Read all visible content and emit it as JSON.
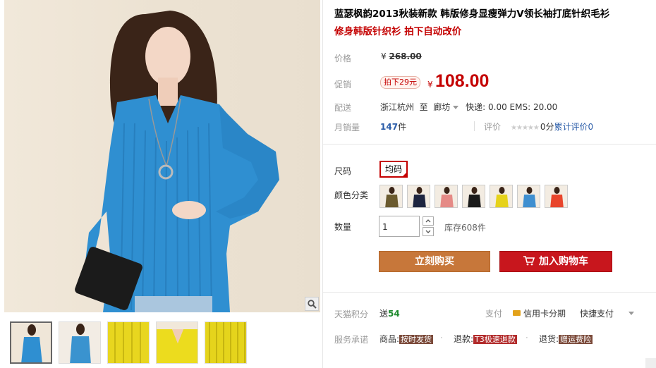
{
  "product": {
    "title": "蓝瑟枫韵2013秋装新款 韩版修身显瘦弹力V领长袖打底针织毛衫",
    "subtitle": "修身韩版针织衫 拍下自动改价"
  },
  "price": {
    "label": "价格",
    "currency": "¥",
    "original": "268.00"
  },
  "promo": {
    "label": "促销",
    "tag": "拍下29元",
    "currency": "¥",
    "price": "108.00"
  },
  "shipping": {
    "label": "配送",
    "from": "浙江杭州",
    "to_word": "至",
    "dest": "廊坊",
    "fees": "快递: 0.00 EMS: 20.00"
  },
  "sales": {
    "label": "月销量",
    "count": "147",
    "unit": "件"
  },
  "rating": {
    "label": "评价",
    "stars": "★★★★★",
    "score": "0分",
    "link_text": "累计评价",
    "count": "0"
  },
  "size": {
    "label": "尺码",
    "selected": "均码"
  },
  "color": {
    "label": "颜色分类",
    "swatches": [
      "#6b5a2e",
      "#1d2540",
      "#e58a86",
      "#1a1a1a",
      "#e6d21a",
      "#3f8fd0",
      "#e8452c"
    ]
  },
  "quantity": {
    "label": "数量",
    "value": "1",
    "stock": "库存608件"
  },
  "buttons": {
    "buy_now": "立刻购买",
    "add_cart": "加入购物车"
  },
  "points": {
    "label": "天猫积分",
    "prefix": "送",
    "value": "54"
  },
  "payment": {
    "label": "支付",
    "card": "信用卡分期",
    "quick": "快捷支付"
  },
  "service": {
    "label": "服务承诺",
    "goods_label": "商品:",
    "goods_tag": "按时发货",
    "return_label": "退款:",
    "return_tag": "T3极速退款",
    "refund_label": "退货:",
    "refund_tag": "赠运费险"
  },
  "colors": {
    "accent_red": "#c40000",
    "buy_button": "#c7773a",
    "cart_button": "#c8161d",
    "link_blue": "#2a5ca8",
    "points_green": "#1e8a2e"
  }
}
